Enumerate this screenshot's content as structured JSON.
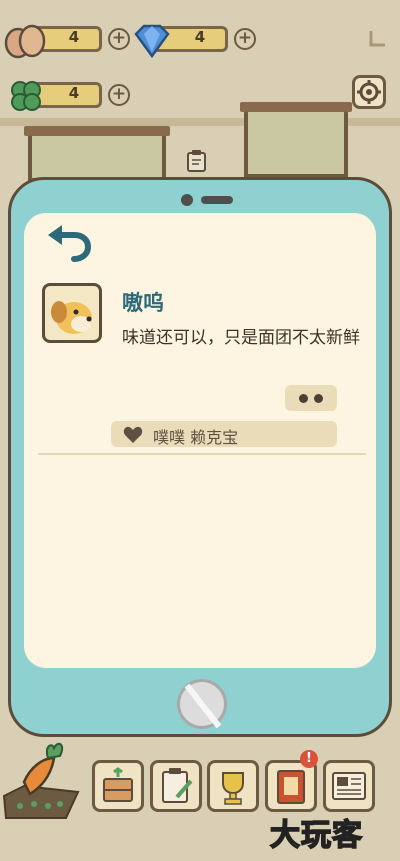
{
  "resources": [
    {
      "name": "egg",
      "value": "4"
    },
    {
      "name": "diamond",
      "value": "4"
    },
    {
      "name": "clover",
      "value": "4"
    }
  ],
  "plus_label": "+",
  "chat": {
    "name": "嗷呜",
    "message": "味道还可以，只是面团不太新鲜",
    "likes": "噗噗 赖克宝"
  },
  "badge_text": "!",
  "watermark": "大玩客",
  "colors": {
    "phone": "#8fd1d0",
    "screen": "#fdf5e1",
    "name": "#2d6a79",
    "badge": "#d9533c"
  },
  "icons": {
    "back": "back-arrow-icon",
    "heart": "heart-icon",
    "settings": "gear-icon",
    "home": "home-button-icon"
  }
}
